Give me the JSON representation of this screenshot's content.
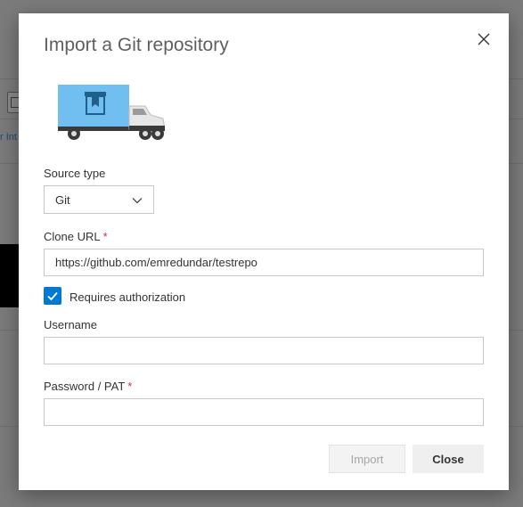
{
  "dialog": {
    "title": "Import a Git repository"
  },
  "backdrop": {
    "link_fragment": "r Int"
  },
  "source_type": {
    "label": "Source type",
    "value": "Git"
  },
  "clone_url": {
    "label": "Clone URL",
    "required_mark": "*",
    "value": "https://github.com/emredundar/testrepo"
  },
  "requires_authorization": {
    "label": "Requires authorization",
    "checked": true
  },
  "username": {
    "label": "Username",
    "value": ""
  },
  "password": {
    "label": "Password / PAT",
    "required_mark": "*",
    "value": ""
  },
  "buttons": {
    "import": "Import",
    "close": "Close"
  },
  "colors": {
    "accent": "#0078d4",
    "required": "#c4314b",
    "truck_box": "#70bff0",
    "title_text": "#5f5f5f"
  },
  "icons": {
    "close": "close-icon",
    "dropdown": "chevron-down-icon",
    "check": "checkmark-icon",
    "hero": "delivery-truck-illustration"
  }
}
